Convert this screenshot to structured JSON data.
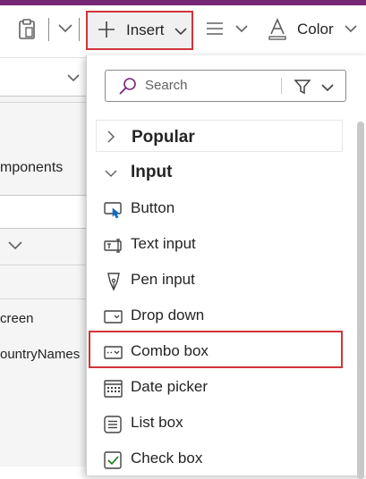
{
  "toolbar": {
    "insert_label": "Insert",
    "color_label": "Color",
    "icons": [
      "paste-icon",
      "chevron-down-icon",
      "plus-icon",
      "align-icon",
      "color-icon"
    ]
  },
  "left_panel": {
    "components_text": "mponents",
    "screen_text": "creen",
    "countrynames_text": "ountryNames"
  },
  "flyout": {
    "search_placeholder": "Search",
    "categories": [
      {
        "label": "Popular",
        "expanded": false
      },
      {
        "label": "Input",
        "expanded": true
      }
    ],
    "items": [
      {
        "label": "Button",
        "icon": "button-icon"
      },
      {
        "label": "Text input",
        "icon": "text-input-icon"
      },
      {
        "label": "Pen input",
        "icon": "pen-input-icon"
      },
      {
        "label": "Drop down",
        "icon": "drop-down-icon"
      },
      {
        "label": "Combo box",
        "icon": "combo-box-icon"
      },
      {
        "label": "Date picker",
        "icon": "date-picker-icon"
      },
      {
        "label": "List box",
        "icon": "list-box-icon"
      },
      {
        "label": "Check box",
        "icon": "check-box-icon"
      }
    ]
  },
  "colors": {
    "brand": "#742774",
    "highlight": "#d13438"
  }
}
